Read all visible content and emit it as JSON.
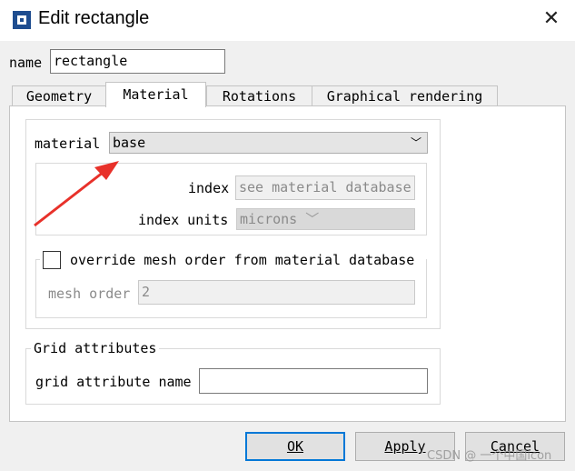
{
  "window": {
    "title": "Edit rectangle"
  },
  "name_field": {
    "label": "name",
    "value": "rectangle"
  },
  "tabs": [
    {
      "label": "Geometry"
    },
    {
      "label": "Material"
    },
    {
      "label": "Rotations"
    },
    {
      "label": "Graphical rendering"
    }
  ],
  "material": {
    "label": "material",
    "value": "base",
    "index_label": "index",
    "index_value": "see material database",
    "index_units_label": "index units",
    "index_units_value": "microns",
    "override_label": "override mesh order from material database",
    "override_checked": false,
    "mesh_order_label": "mesh order",
    "mesh_order_value": "2"
  },
  "grid": {
    "group_title": "Grid attributes",
    "attribute_label": "grid attribute name",
    "attribute_value": ""
  },
  "buttons": {
    "ok": "OK",
    "apply": "Apply",
    "cancel": "Cancel"
  },
  "watermark": "CSDN @ 一个中国icon",
  "annotation": {
    "arrow_color": "#e8312a"
  }
}
